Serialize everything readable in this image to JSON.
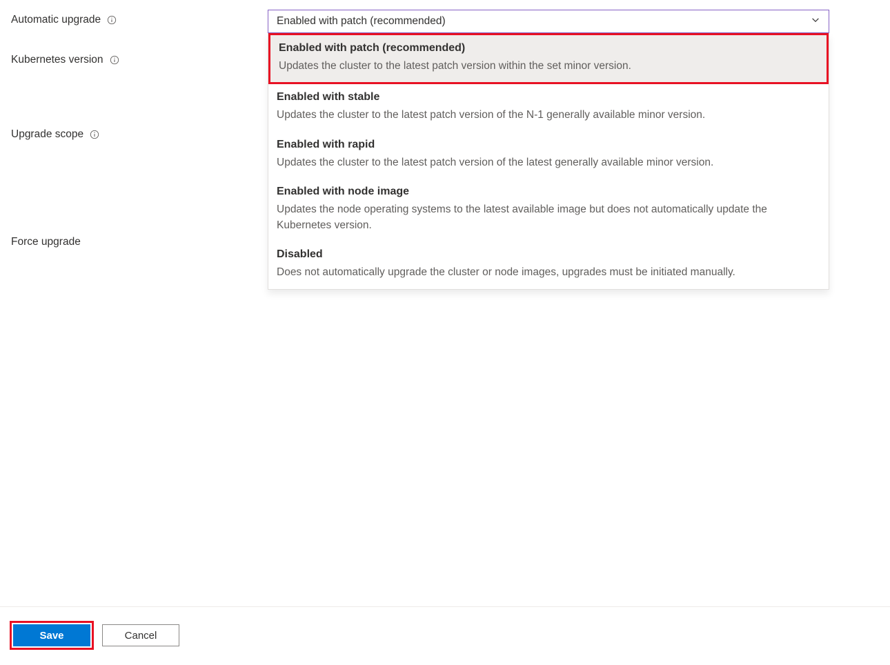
{
  "labels": {
    "automatic_upgrade": "Automatic upgrade",
    "kubernetes_version": "Kubernetes version",
    "upgrade_scope": "Upgrade scope",
    "force_upgrade": "Force upgrade"
  },
  "dropdown": {
    "selected": "Enabled with patch (recommended)",
    "options": [
      {
        "title": "Enabled with patch (recommended)",
        "desc": "Updates the cluster to the latest patch version within the set minor version."
      },
      {
        "title": "Enabled with stable",
        "desc": "Updates the cluster to the latest patch version of the N-1 generally available minor version."
      },
      {
        "title": "Enabled with rapid",
        "desc": "Updates the cluster to the latest patch version of the latest generally available minor version."
      },
      {
        "title": "Enabled with node image",
        "desc": "Updates the node operating systems to the latest available image but does not automatically update the Kubernetes version."
      },
      {
        "title": "Disabled",
        "desc": "Does not automatically upgrade the cluster or node images, upgrades must be initiated manually."
      }
    ]
  },
  "buttons": {
    "save": "Save",
    "cancel": "Cancel"
  }
}
